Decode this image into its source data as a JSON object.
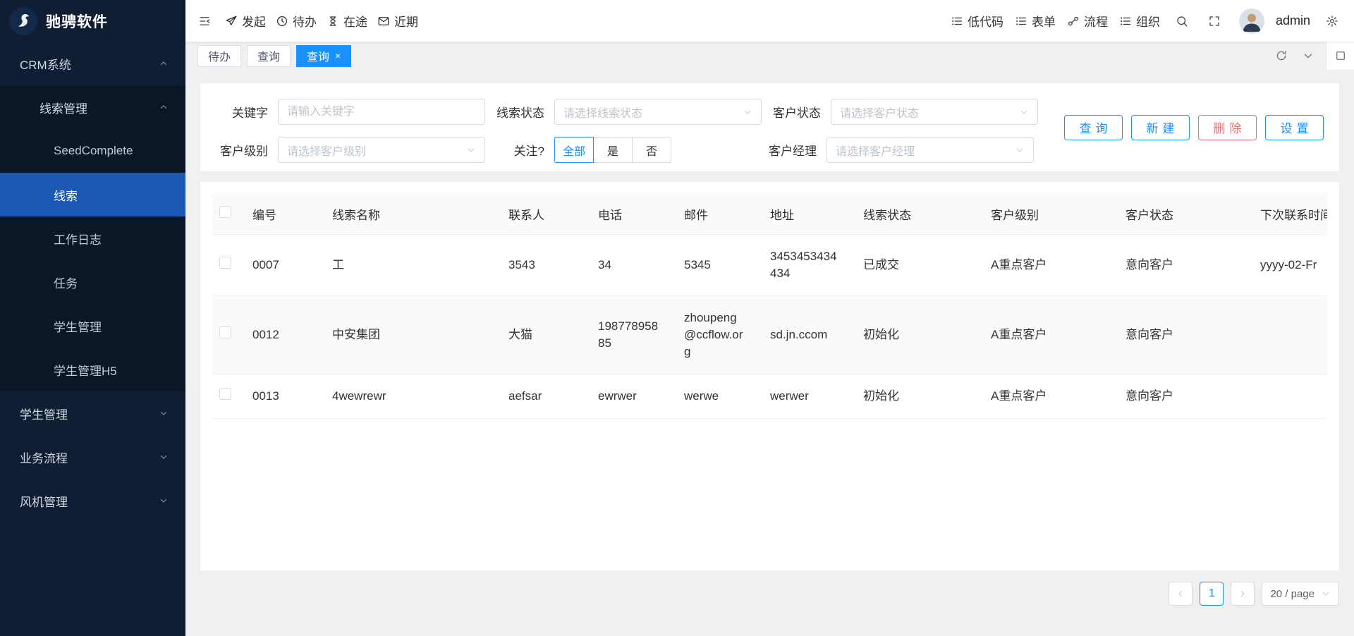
{
  "brand": {
    "name": "驰骋软件",
    "logo_icon": "swan-logo-icon"
  },
  "sidebar": {
    "menu": [
      {
        "label": "CRM系统",
        "expanded": true,
        "children": [
          {
            "label": "线索管理",
            "expanded": true,
            "children": [
              {
                "label": "SeedComplete"
              },
              {
                "label": "线索",
                "active": true
              },
              {
                "label": "工作日志"
              },
              {
                "label": "任务"
              },
              {
                "label": "学生管理"
              },
              {
                "label": "学生管理H5"
              }
            ]
          }
        ]
      },
      {
        "label": "学生管理",
        "expanded": false
      },
      {
        "label": "业务流程",
        "expanded": false
      },
      {
        "label": "风机管理",
        "expanded": false
      }
    ]
  },
  "header": {
    "nav_left": [
      {
        "icon": "send-icon",
        "label": "发起"
      },
      {
        "icon": "clock-icon",
        "label": "待办"
      },
      {
        "icon": "hourglass-icon",
        "label": "在途"
      },
      {
        "icon": "mail-icon",
        "label": "近期"
      }
    ],
    "nav_right": [
      {
        "icon": "list-icon",
        "label": "低代码"
      },
      {
        "icon": "list-icon",
        "label": "表单"
      },
      {
        "icon": "flow-icon",
        "label": "流程"
      },
      {
        "icon": "list-icon",
        "label": "组织"
      }
    ],
    "tools": [
      "search-icon",
      "fullscreen-icon",
      "gear-icon"
    ],
    "user": "admin"
  },
  "tabs": [
    {
      "label": "待办",
      "active": false
    },
    {
      "label": "查询",
      "active": false
    },
    {
      "label": "查询",
      "active": true,
      "close": "×"
    }
  ],
  "filters": {
    "keyword": {
      "label": "关键字",
      "placeholder": "请输入关键字",
      "value": ""
    },
    "lead_status": {
      "label": "线索状态",
      "placeholder": "请选择线索状态"
    },
    "customer_status": {
      "label": "客户状态",
      "placeholder": "请选择客户状态"
    },
    "customer_level": {
      "label": "客户级别",
      "placeholder": "请选择客户级别"
    },
    "follow": {
      "label": "关注?",
      "options": [
        "全部",
        "是",
        "否"
      ],
      "selected": "全部"
    },
    "customer_manager": {
      "label": "客户经理",
      "placeholder": "请选择客户经理"
    }
  },
  "actions": {
    "query": "查询",
    "create": "新建",
    "delete": "删除",
    "settings": "设置"
  },
  "table": {
    "columns": [
      "编号",
      "线索名称",
      "联系人",
      "电话",
      "邮件",
      "地址",
      "线索状态",
      "客户级别",
      "客户状态",
      "下次联系时间"
    ],
    "rows": [
      [
        "0007",
        "工",
        "3543",
        "34",
        "5345",
        "3453453434434",
        "已成交",
        "A重点客户",
        "意向客户",
        "yyyy-02-Fr"
      ],
      [
        "0012",
        "中安集团",
        "大猫",
        "19877895885",
        "zhoupeng@ccflow.org",
        "sd.jn.ccom",
        "初始化",
        "A重点客户",
        "意向客户",
        ""
      ],
      [
        "0013",
        "4wewrewr",
        "aefsar",
        "ewrwer",
        "werwe",
        "werwer",
        "初始化",
        "A重点客户",
        "意向客户",
        ""
      ]
    ]
  },
  "pagination": {
    "current": "1",
    "page_size": "20 / page"
  },
  "colors": {
    "primary": "#1890ff",
    "danger": "#f56c6c",
    "sidebar_bg": "#0f1e33",
    "sidebar_submenu_bg": "#0b1726",
    "sidebar_active_bg": "#1c59b5",
    "content_bg": "#f0f0f0"
  }
}
